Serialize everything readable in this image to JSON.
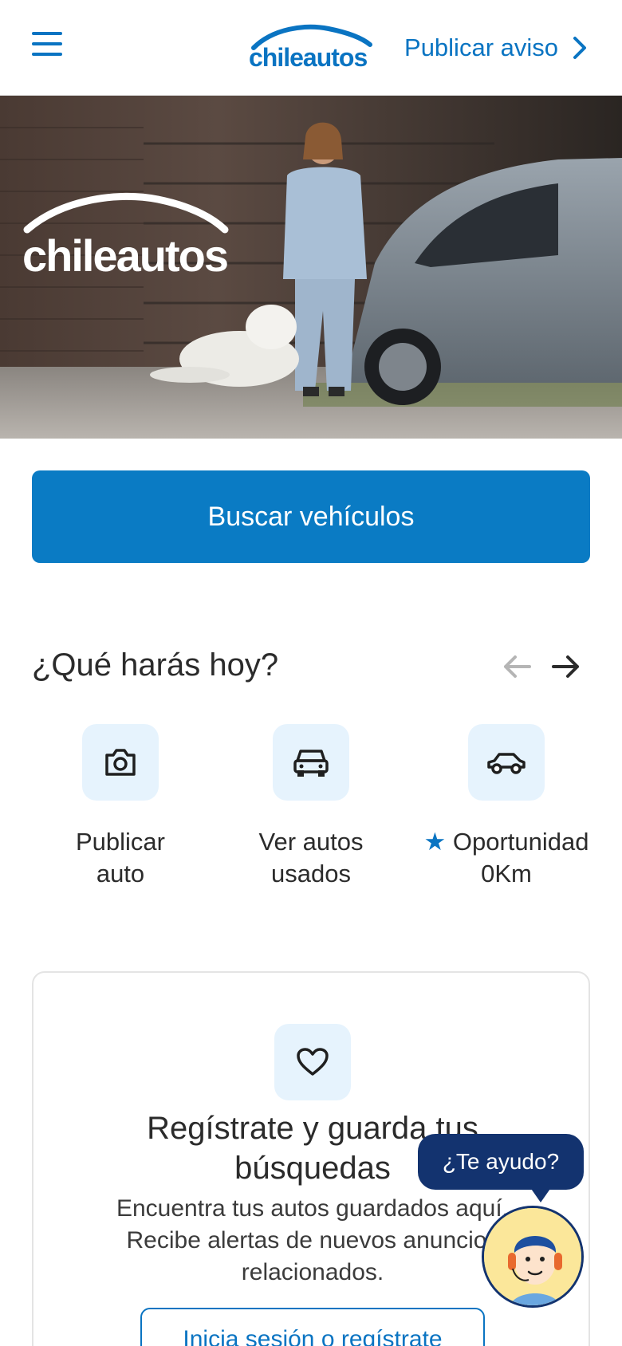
{
  "header": {
    "brand": "chileautos",
    "publish_label": "Publicar aviso"
  },
  "hero": {
    "brand": "chileautos"
  },
  "search": {
    "button_label": "Buscar vehículos"
  },
  "actions": {
    "title": "¿Qué harás hoy?",
    "items": [
      {
        "line1": "Publicar",
        "line2": "auto",
        "icon": "camera-icon"
      },
      {
        "line1": "Ver autos",
        "line2": "usados",
        "icon": "car-front-icon"
      },
      {
        "line1": "Oportunidad",
        "line2": "0Km",
        "icon": "car-side-icon",
        "badge_icon": "star-icon"
      }
    ]
  },
  "register_card": {
    "title_line1": "Regístrate y guarda tus",
    "title_line2": "búsquedas",
    "desc_line1": "Encuentra tus autos guardados aquí.",
    "desc_line2": "Recibe alertas de nuevos anuncios",
    "desc_line3": "relacionados.",
    "button_label": "Inicia sesión o regístrate"
  },
  "help": {
    "label": "¿Te ayudo?"
  },
  "colors": {
    "primary": "#0a7bc4",
    "brand_blue": "#0a74c2",
    "help_navy": "#13336f",
    "icon_bg": "#e6f3fd"
  }
}
